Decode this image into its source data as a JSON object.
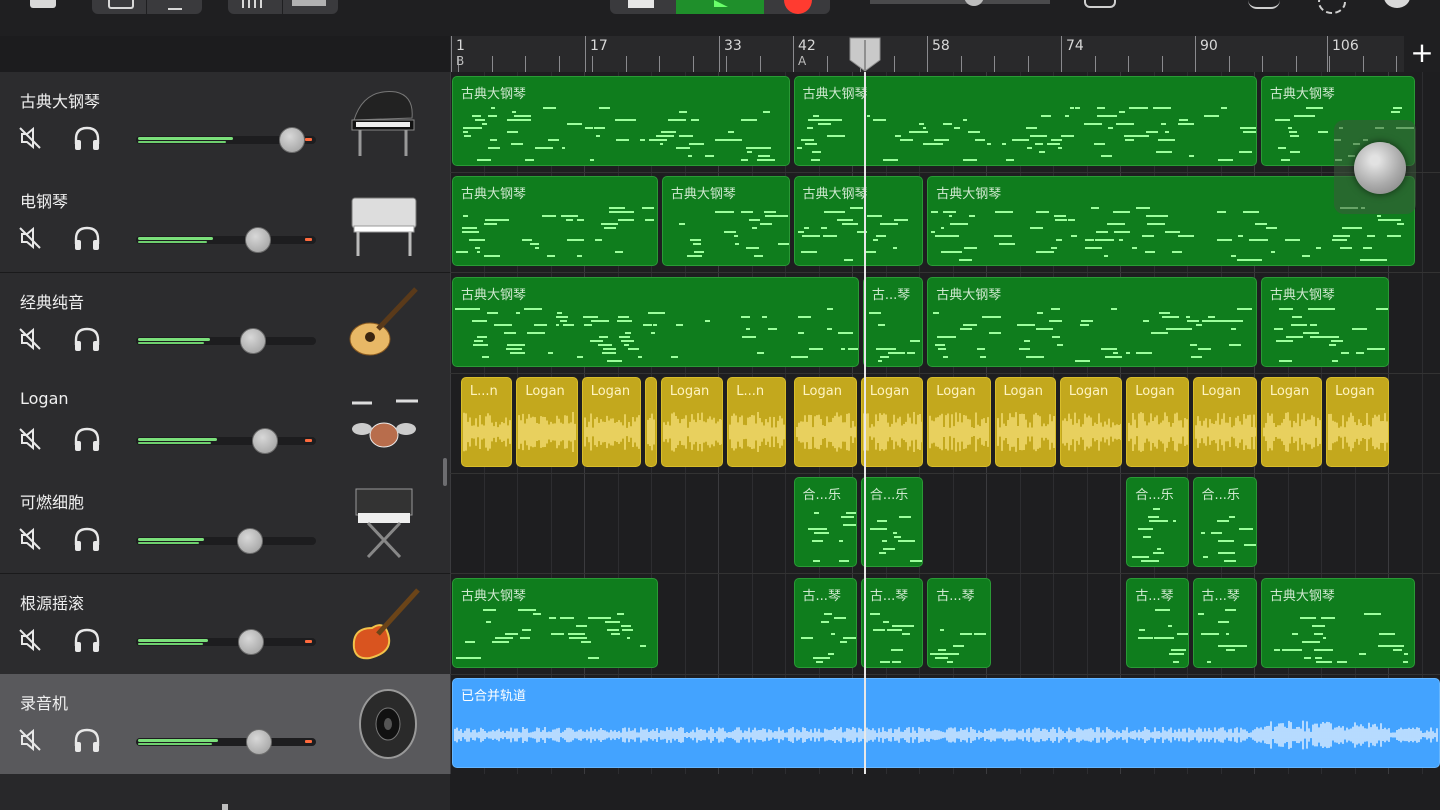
{
  "colors": {
    "midi_region": "#0f7d1d",
    "audio_region": "#c3a81d",
    "recorder_region": "#43a3ff",
    "play_button": "#1f8f2b",
    "record_button": "#ff3b30",
    "selected_track": "#59595c"
  },
  "toolbar": {
    "icons": [
      "browser-icon",
      "view-toggle-icon",
      "microphone-icon",
      "mixer-icon",
      "fx-icon",
      "stop-icon",
      "play-icon",
      "record-icon",
      "master-volume-icon",
      "loop-icon",
      "metronome-icon",
      "settings-icon",
      "help-icon"
    ]
  },
  "ruler": {
    "bars": [
      "1",
      "17",
      "33",
      "42",
      "58",
      "74",
      "90",
      "106"
    ],
    "markers": [
      {
        "bar_index": 0,
        "letter": "B"
      },
      {
        "bar_index": 3,
        "letter": "A"
      }
    ],
    "add_track_label": "+"
  },
  "tracks": [
    {
      "name": "古典大钢琴",
      "icon": "grand-piano-icon",
      "volume": 0.86,
      "peak_color": "#ff6a3d",
      "selected": false,
      "regions": [
        {
          "label": "古典大钢琴",
          "kind": "midi",
          "start": 0,
          "end": 0.343
        },
        {
          "label": "古典大钢琴",
          "kind": "midi",
          "start": 0.345,
          "end": 0.815
        },
        {
          "label": "古典大钢琴",
          "kind": "midi",
          "start": 0.817,
          "end": 0.975
        }
      ]
    },
    {
      "name": "电钢琴",
      "icon": "electric-piano-icon",
      "volume": 0.68,
      "peak_color": "#ff6a3d",
      "selected": false,
      "regions": [
        {
          "label": "古典大钢琴",
          "kind": "midi",
          "start": 0,
          "end": 0.21
        },
        {
          "label": "古典大钢琴",
          "kind": "midi",
          "start": 0.212,
          "end": 0.343
        },
        {
          "label": "古典大钢琴",
          "kind": "midi",
          "start": 0.345,
          "end": 0.478
        },
        {
          "label": "古典大钢琴",
          "kind": "midi",
          "start": 0.48,
          "end": 0.975
        }
      ]
    },
    {
      "name": "经典纯音",
      "icon": "hollow-guitar-icon",
      "volume": 0.65,
      "peak_color": null,
      "selected": false,
      "regions": [
        {
          "label": "古典大钢琴",
          "kind": "midi",
          "start": 0,
          "end": 0.413
        },
        {
          "label": "古...琴",
          "kind": "midi",
          "start": 0.415,
          "end": 0.478
        },
        {
          "label": "古典大钢琴",
          "kind": "midi",
          "start": 0.48,
          "end": 0.815
        },
        {
          "label": "古典大钢琴",
          "kind": "midi",
          "start": 0.817,
          "end": 0.948
        }
      ]
    },
    {
      "name": "Logan",
      "icon": "drum-kit-icon",
      "volume": 0.72,
      "peak_color": "#ff6a3d",
      "selected": false,
      "regions": [
        {
          "label": "L...n",
          "kind": "audio",
          "start": 0.009,
          "end": 0.063
        },
        {
          "label": "Logan",
          "kind": "audio",
          "start": 0.065,
          "end": 0.129
        },
        {
          "label": "Logan",
          "kind": "audio",
          "start": 0.131,
          "end": 0.193
        },
        {
          "label": "",
          "kind": "audio",
          "start": 0.195,
          "end": 0.209
        },
        {
          "label": "Logan",
          "kind": "audio",
          "start": 0.211,
          "end": 0.276
        },
        {
          "label": "L...n",
          "kind": "audio",
          "start": 0.278,
          "end": 0.339
        },
        {
          "label": "Logan",
          "kind": "audio",
          "start": 0.345,
          "end": 0.411
        },
        {
          "label": "Logan",
          "kind": "audio",
          "start": 0.413,
          "end": 0.478
        },
        {
          "label": "Logan",
          "kind": "audio",
          "start": 0.48,
          "end": 0.546
        },
        {
          "label": "Logan",
          "kind": "audio",
          "start": 0.548,
          "end": 0.612
        },
        {
          "label": "Logan",
          "kind": "audio",
          "start": 0.614,
          "end": 0.679
        },
        {
          "label": "Logan",
          "kind": "audio",
          "start": 0.681,
          "end": 0.746
        },
        {
          "label": "Logan",
          "kind": "audio",
          "start": 0.748,
          "end": 0.815
        },
        {
          "label": "Logan",
          "kind": "audio",
          "start": 0.817,
          "end": 0.881
        },
        {
          "label": "Logan",
          "kind": "audio",
          "start": 0.883,
          "end": 0.948
        }
      ]
    },
    {
      "name": "可燃细胞",
      "icon": "synthesizer-icon",
      "volume": 0.6,
      "peak_color": null,
      "selected": false,
      "regions": [
        {
          "label": "合...乐",
          "kind": "midi",
          "start": 0.345,
          "end": 0.411
        },
        {
          "label": "合...乐",
          "kind": "midi",
          "start": 0.413,
          "end": 0.478
        },
        {
          "label": "合...乐",
          "kind": "midi",
          "start": 0.681,
          "end": 0.746
        },
        {
          "label": "合...乐",
          "kind": "midi",
          "start": 0.748,
          "end": 0.815
        }
      ]
    },
    {
      "name": "根源摇滚",
      "icon": "electric-guitar-icon",
      "volume": 0.64,
      "peak_color": "#ff6a3d",
      "selected": false,
      "regions": [
        {
          "label": "古典大钢琴",
          "kind": "midi",
          "start": 0,
          "end": 0.21
        },
        {
          "label": "古...琴",
          "kind": "midi",
          "start": 0.345,
          "end": 0.411
        },
        {
          "label": "古...琴",
          "kind": "midi",
          "start": 0.413,
          "end": 0.478
        },
        {
          "label": "古...琴",
          "kind": "midi",
          "start": 0.48,
          "end": 0.546
        },
        {
          "label": "古...琴",
          "kind": "midi",
          "start": 0.681,
          "end": 0.746
        },
        {
          "label": "古...琴",
          "kind": "midi",
          "start": 0.748,
          "end": 0.815
        },
        {
          "label": "古典大钢琴",
          "kind": "midi",
          "start": 0.817,
          "end": 0.975
        }
      ]
    },
    {
      "name": "录音机",
      "icon": "speaker-icon",
      "volume": 0.73,
      "peak_color": "#ff6a3d",
      "selected": true,
      "regions": [
        {
          "label": "已合并轨道",
          "kind": "rec",
          "start": 0,
          "end": 1.0
        }
      ]
    }
  ]
}
